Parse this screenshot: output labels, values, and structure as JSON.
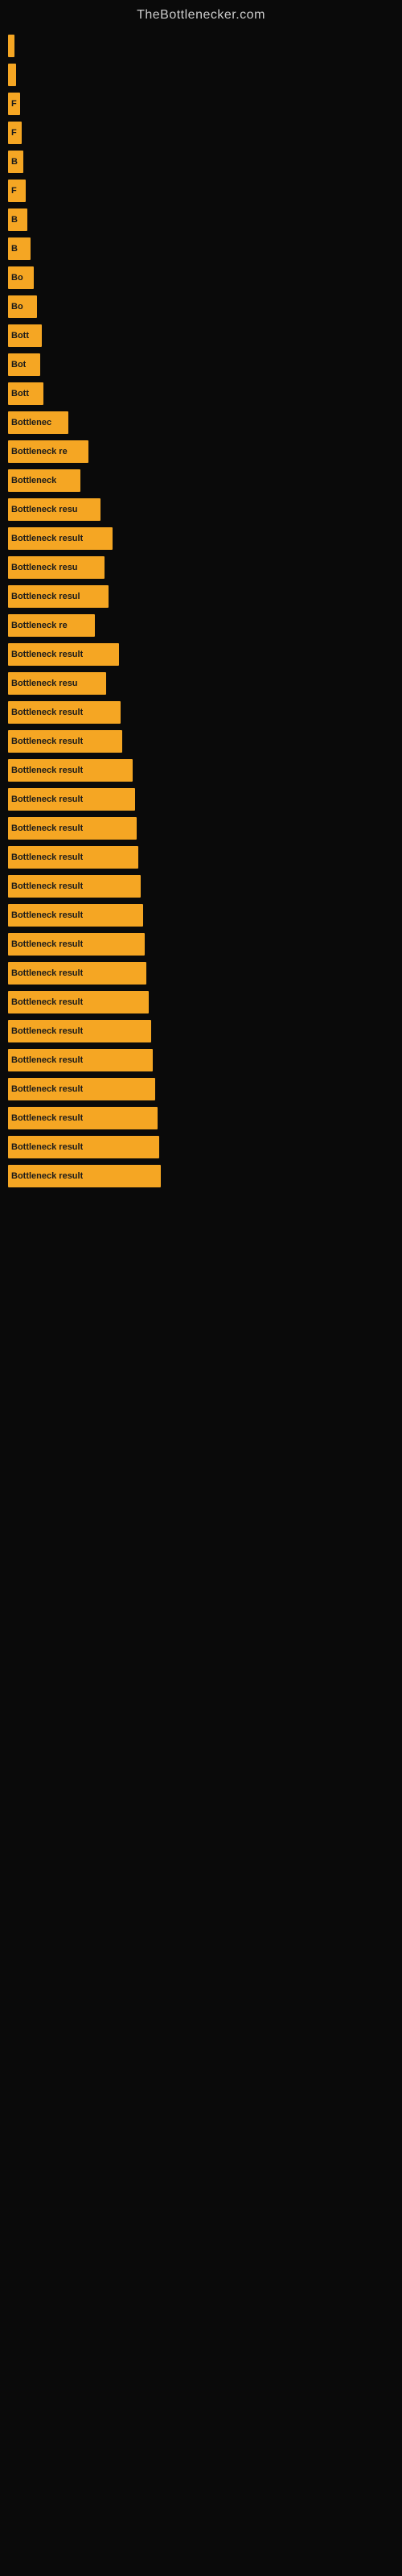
{
  "siteTitle": "TheBottlenecker.com",
  "bars": [
    {
      "id": 1,
      "label": "",
      "width": 8
    },
    {
      "id": 2,
      "label": "",
      "width": 10
    },
    {
      "id": 3,
      "label": "F",
      "width": 15
    },
    {
      "id": 4,
      "label": "F",
      "width": 17
    },
    {
      "id": 5,
      "label": "B",
      "width": 19
    },
    {
      "id": 6,
      "label": "F",
      "width": 22
    },
    {
      "id": 7,
      "label": "B",
      "width": 24
    },
    {
      "id": 8,
      "label": "B",
      "width": 28
    },
    {
      "id": 9,
      "label": "Bo",
      "width": 32
    },
    {
      "id": 10,
      "label": "Bo",
      "width": 36
    },
    {
      "id": 11,
      "label": "Bott",
      "width": 42
    },
    {
      "id": 12,
      "label": "Bot",
      "width": 40
    },
    {
      "id": 13,
      "label": "Bott",
      "width": 44
    },
    {
      "id": 14,
      "label": "Bottlenec",
      "width": 75
    },
    {
      "id": 15,
      "label": "Bottleneck re",
      "width": 100
    },
    {
      "id": 16,
      "label": "Bottleneck",
      "width": 90
    },
    {
      "id": 17,
      "label": "Bottleneck resu",
      "width": 115
    },
    {
      "id": 18,
      "label": "Bottleneck result",
      "width": 130
    },
    {
      "id": 19,
      "label": "Bottleneck resu",
      "width": 120
    },
    {
      "id": 20,
      "label": "Bottleneck resul",
      "width": 125
    },
    {
      "id": 21,
      "label": "Bottleneck re",
      "width": 108
    },
    {
      "id": 22,
      "label": "Bottleneck result",
      "width": 138
    },
    {
      "id": 23,
      "label": "Bottleneck resu",
      "width": 122
    },
    {
      "id": 24,
      "label": "Bottleneck result",
      "width": 140
    },
    {
      "id": 25,
      "label": "Bottleneck result",
      "width": 142
    },
    {
      "id": 26,
      "label": "Bottleneck result",
      "width": 155
    },
    {
      "id": 27,
      "label": "Bottleneck result",
      "width": 158
    },
    {
      "id": 28,
      "label": "Bottleneck result",
      "width": 160
    },
    {
      "id": 29,
      "label": "Bottleneck result",
      "width": 162
    },
    {
      "id": 30,
      "label": "Bottleneck result",
      "width": 165
    },
    {
      "id": 31,
      "label": "Bottleneck result",
      "width": 168
    },
    {
      "id": 32,
      "label": "Bottleneck result",
      "width": 170
    },
    {
      "id": 33,
      "label": "Bottleneck result",
      "width": 172
    },
    {
      "id": 34,
      "label": "Bottleneck result",
      "width": 175
    },
    {
      "id": 35,
      "label": "Bottleneck result",
      "width": 178
    },
    {
      "id": 36,
      "label": "Bottleneck result",
      "width": 180
    },
    {
      "id": 37,
      "label": "Bottleneck result",
      "width": 183
    },
    {
      "id": 38,
      "label": "Bottleneck result",
      "width": 186
    },
    {
      "id": 39,
      "label": "Bottleneck result",
      "width": 188
    },
    {
      "id": 40,
      "label": "Bottleneck result",
      "width": 190
    }
  ]
}
